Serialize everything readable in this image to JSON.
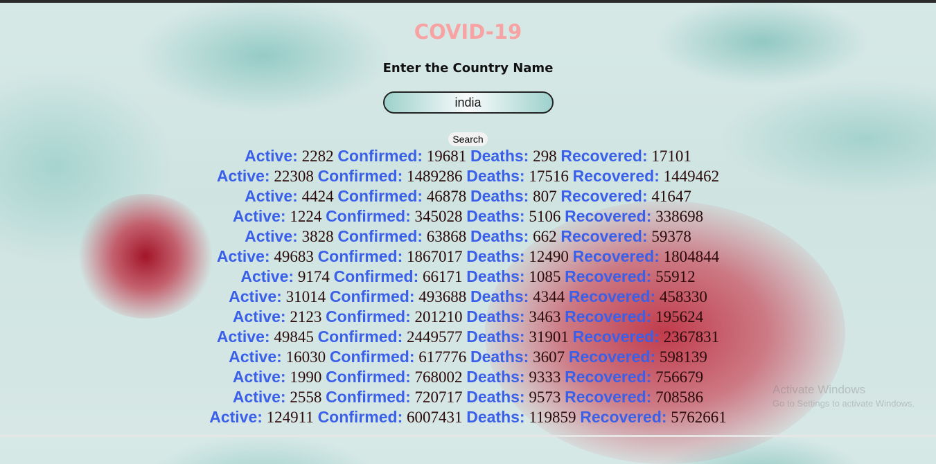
{
  "app": {
    "title": "COVID-19",
    "prompt": "Enter the Country Name"
  },
  "search": {
    "value": "india",
    "button_label": "Search"
  },
  "labels": {
    "active": "Active:",
    "confirmed": "Confirmed:",
    "deaths": "Deaths:",
    "recovered": "Recovered:"
  },
  "results": [
    {
      "active": "2282",
      "confirmed": "19681",
      "deaths": "298",
      "recovered": "17101"
    },
    {
      "active": "22308",
      "confirmed": "1489286",
      "deaths": "17516",
      "recovered": "1449462"
    },
    {
      "active": "4424",
      "confirmed": "46878",
      "deaths": "807",
      "recovered": "41647"
    },
    {
      "active": "1224",
      "confirmed": "345028",
      "deaths": "5106",
      "recovered": "338698"
    },
    {
      "active": "3828",
      "confirmed": "63868",
      "deaths": "662",
      "recovered": "59378"
    },
    {
      "active": "49683",
      "confirmed": "1867017",
      "deaths": "12490",
      "recovered": "1804844"
    },
    {
      "active": "9174",
      "confirmed": "66171",
      "deaths": "1085",
      "recovered": "55912"
    },
    {
      "active": "31014",
      "confirmed": "493688",
      "deaths": "4344",
      "recovered": "458330"
    },
    {
      "active": "2123",
      "confirmed": "201210",
      "deaths": "3463",
      "recovered": "195624"
    },
    {
      "active": "49845",
      "confirmed": "2449577",
      "deaths": "31901",
      "recovered": "2367831"
    },
    {
      "active": "16030",
      "confirmed": "617776",
      "deaths": "3607",
      "recovered": "598139"
    },
    {
      "active": "1990",
      "confirmed": "768002",
      "deaths": "9333",
      "recovered": "756679"
    },
    {
      "active": "2558",
      "confirmed": "720717",
      "deaths": "9573",
      "recovered": "708586"
    },
    {
      "active": "124911",
      "confirmed": "6007431",
      "deaths": "119859",
      "recovered": "5762661"
    }
  ],
  "watermark": {
    "line1": "Activate Windows",
    "line2": "Go to Settings to activate Windows."
  }
}
